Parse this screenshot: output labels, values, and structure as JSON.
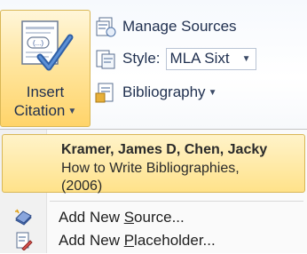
{
  "ribbon": {
    "insert_citation": {
      "line1": "Insert",
      "line2": "Citation"
    },
    "manage_sources": "Manage Sources",
    "style_label": "Style:",
    "style_value": "MLA Sixt",
    "bibliography": "Bibliography"
  },
  "menu": {
    "citation": {
      "author": "Kramer, James D,  Chen, Jacky",
      "title": "How to Write Bibliographies,",
      "year": "(2006)"
    },
    "add_source": {
      "pre": "Add New ",
      "key": "S",
      "post": "ource..."
    },
    "add_placeholder": {
      "pre": "Add New ",
      "key": "P",
      "post": "laceholder..."
    }
  },
  "colors": {
    "highlight_top": "#fff3c9",
    "highlight_bottom": "#ffe28a",
    "highlight_border": "#d9b756"
  },
  "icons": [
    "insert-citation-icon",
    "manage-sources-icon",
    "style-icon",
    "bibliography-icon",
    "add-source-icon",
    "add-placeholder-icon"
  ]
}
